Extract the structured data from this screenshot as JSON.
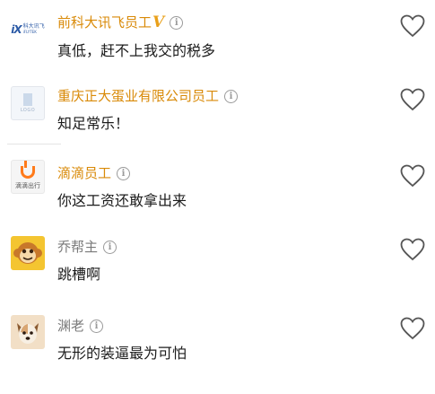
{
  "comments": [
    {
      "name": "前科大讯飞员工",
      "verified_mark": "V",
      "text": "真低，赶不上我交的税多",
      "avatar": "iflytek-logo",
      "avatar_text": "科大讯飞"
    },
    {
      "name": "重庆正大蛋业有限公司员工",
      "text": "知足常乐！",
      "avatar": "logo-placeholder",
      "avatar_text": "LOGO"
    },
    {
      "name": "滴滴员工",
      "text": "你这工资还敢拿出来",
      "avatar": "didi-logo",
      "avatar_text": "滴滴出行"
    },
    {
      "name": "乔帮主",
      "text": "跳槽啊",
      "avatar": "monkey-avatar"
    },
    {
      "name": "渊老",
      "text": "无形的装逼最为可怕",
      "avatar": "dog-avatar"
    }
  ],
  "info_glyph": "i",
  "colors": {
    "verified_name": "#d98a08",
    "plain_name": "#7a7a7a",
    "text": "#1c1c1c",
    "icon_gray": "#9a9a9a"
  }
}
